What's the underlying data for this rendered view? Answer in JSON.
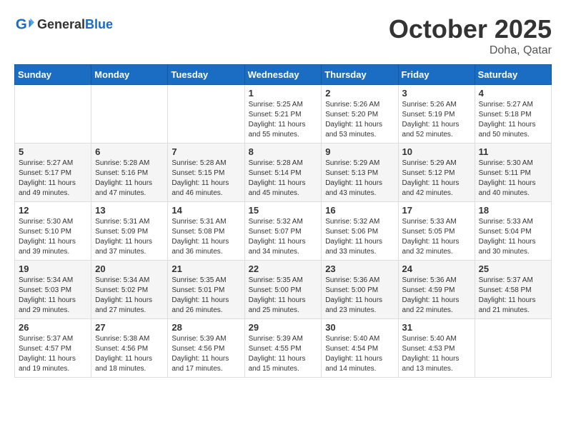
{
  "header": {
    "logo_general": "General",
    "logo_blue": "Blue",
    "month": "October 2025",
    "location": "Doha, Qatar"
  },
  "weekdays": [
    "Sunday",
    "Monday",
    "Tuesday",
    "Wednesday",
    "Thursday",
    "Friday",
    "Saturday"
  ],
  "weeks": [
    [
      {
        "day": "",
        "sunrise": "",
        "sunset": "",
        "daylight": ""
      },
      {
        "day": "",
        "sunrise": "",
        "sunset": "",
        "daylight": ""
      },
      {
        "day": "",
        "sunrise": "",
        "sunset": "",
        "daylight": ""
      },
      {
        "day": "1",
        "sunrise": "Sunrise: 5:25 AM",
        "sunset": "Sunset: 5:21 PM",
        "daylight": "Daylight: 11 hours and 55 minutes."
      },
      {
        "day": "2",
        "sunrise": "Sunrise: 5:26 AM",
        "sunset": "Sunset: 5:20 PM",
        "daylight": "Daylight: 11 hours and 53 minutes."
      },
      {
        "day": "3",
        "sunrise": "Sunrise: 5:26 AM",
        "sunset": "Sunset: 5:19 PM",
        "daylight": "Daylight: 11 hours and 52 minutes."
      },
      {
        "day": "4",
        "sunrise": "Sunrise: 5:27 AM",
        "sunset": "Sunset: 5:18 PM",
        "daylight": "Daylight: 11 hours and 50 minutes."
      }
    ],
    [
      {
        "day": "5",
        "sunrise": "Sunrise: 5:27 AM",
        "sunset": "Sunset: 5:17 PM",
        "daylight": "Daylight: 11 hours and 49 minutes."
      },
      {
        "day": "6",
        "sunrise": "Sunrise: 5:28 AM",
        "sunset": "Sunset: 5:16 PM",
        "daylight": "Daylight: 11 hours and 47 minutes."
      },
      {
        "day": "7",
        "sunrise": "Sunrise: 5:28 AM",
        "sunset": "Sunset: 5:15 PM",
        "daylight": "Daylight: 11 hours and 46 minutes."
      },
      {
        "day": "8",
        "sunrise": "Sunrise: 5:28 AM",
        "sunset": "Sunset: 5:14 PM",
        "daylight": "Daylight: 11 hours and 45 minutes."
      },
      {
        "day": "9",
        "sunrise": "Sunrise: 5:29 AM",
        "sunset": "Sunset: 5:13 PM",
        "daylight": "Daylight: 11 hours and 43 minutes."
      },
      {
        "day": "10",
        "sunrise": "Sunrise: 5:29 AM",
        "sunset": "Sunset: 5:12 PM",
        "daylight": "Daylight: 11 hours and 42 minutes."
      },
      {
        "day": "11",
        "sunrise": "Sunrise: 5:30 AM",
        "sunset": "Sunset: 5:11 PM",
        "daylight": "Daylight: 11 hours and 40 minutes."
      }
    ],
    [
      {
        "day": "12",
        "sunrise": "Sunrise: 5:30 AM",
        "sunset": "Sunset: 5:10 PM",
        "daylight": "Daylight: 11 hours and 39 minutes."
      },
      {
        "day": "13",
        "sunrise": "Sunrise: 5:31 AM",
        "sunset": "Sunset: 5:09 PM",
        "daylight": "Daylight: 11 hours and 37 minutes."
      },
      {
        "day": "14",
        "sunrise": "Sunrise: 5:31 AM",
        "sunset": "Sunset: 5:08 PM",
        "daylight": "Daylight: 11 hours and 36 minutes."
      },
      {
        "day": "15",
        "sunrise": "Sunrise: 5:32 AM",
        "sunset": "Sunset: 5:07 PM",
        "daylight": "Daylight: 11 hours and 34 minutes."
      },
      {
        "day": "16",
        "sunrise": "Sunrise: 5:32 AM",
        "sunset": "Sunset: 5:06 PM",
        "daylight": "Daylight: 11 hours and 33 minutes."
      },
      {
        "day": "17",
        "sunrise": "Sunrise: 5:33 AM",
        "sunset": "Sunset: 5:05 PM",
        "daylight": "Daylight: 11 hours and 32 minutes."
      },
      {
        "day": "18",
        "sunrise": "Sunrise: 5:33 AM",
        "sunset": "Sunset: 5:04 PM",
        "daylight": "Daylight: 11 hours and 30 minutes."
      }
    ],
    [
      {
        "day": "19",
        "sunrise": "Sunrise: 5:34 AM",
        "sunset": "Sunset: 5:03 PM",
        "daylight": "Daylight: 11 hours and 29 minutes."
      },
      {
        "day": "20",
        "sunrise": "Sunrise: 5:34 AM",
        "sunset": "Sunset: 5:02 PM",
        "daylight": "Daylight: 11 hours and 27 minutes."
      },
      {
        "day": "21",
        "sunrise": "Sunrise: 5:35 AM",
        "sunset": "Sunset: 5:01 PM",
        "daylight": "Daylight: 11 hours and 26 minutes."
      },
      {
        "day": "22",
        "sunrise": "Sunrise: 5:35 AM",
        "sunset": "Sunset: 5:00 PM",
        "daylight": "Daylight: 11 hours and 25 minutes."
      },
      {
        "day": "23",
        "sunrise": "Sunrise: 5:36 AM",
        "sunset": "Sunset: 5:00 PM",
        "daylight": "Daylight: 11 hours and 23 minutes."
      },
      {
        "day": "24",
        "sunrise": "Sunrise: 5:36 AM",
        "sunset": "Sunset: 4:59 PM",
        "daylight": "Daylight: 11 hours and 22 minutes."
      },
      {
        "day": "25",
        "sunrise": "Sunrise: 5:37 AM",
        "sunset": "Sunset: 4:58 PM",
        "daylight": "Daylight: 11 hours and 21 minutes."
      }
    ],
    [
      {
        "day": "26",
        "sunrise": "Sunrise: 5:37 AM",
        "sunset": "Sunset: 4:57 PM",
        "daylight": "Daylight: 11 hours and 19 minutes."
      },
      {
        "day": "27",
        "sunrise": "Sunrise: 5:38 AM",
        "sunset": "Sunset: 4:56 PM",
        "daylight": "Daylight: 11 hours and 18 minutes."
      },
      {
        "day": "28",
        "sunrise": "Sunrise: 5:39 AM",
        "sunset": "Sunset: 4:56 PM",
        "daylight": "Daylight: 11 hours and 17 minutes."
      },
      {
        "day": "29",
        "sunrise": "Sunrise: 5:39 AM",
        "sunset": "Sunset: 4:55 PM",
        "daylight": "Daylight: 11 hours and 15 minutes."
      },
      {
        "day": "30",
        "sunrise": "Sunrise: 5:40 AM",
        "sunset": "Sunset: 4:54 PM",
        "daylight": "Daylight: 11 hours and 14 minutes."
      },
      {
        "day": "31",
        "sunrise": "Sunrise: 5:40 AM",
        "sunset": "Sunset: 4:53 PM",
        "daylight": "Daylight: 11 hours and 13 minutes."
      },
      {
        "day": "",
        "sunrise": "",
        "sunset": "",
        "daylight": ""
      }
    ]
  ]
}
